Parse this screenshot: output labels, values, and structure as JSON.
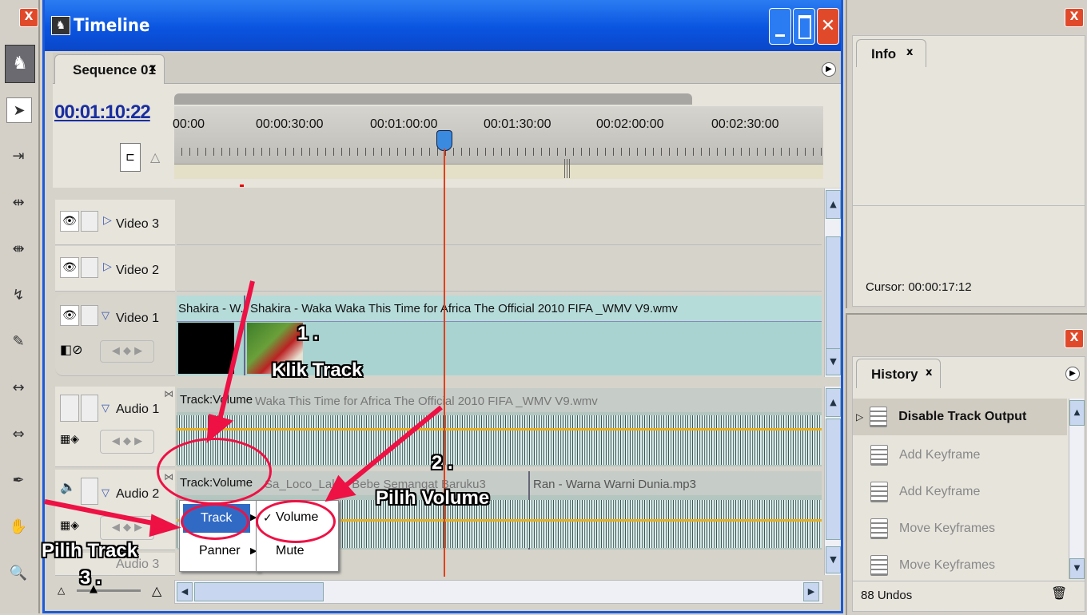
{
  "tools": {
    "close": "X"
  },
  "timeline": {
    "title": "Timeline",
    "tab": "Sequence 01",
    "tab_close": "x",
    "timecode": "00:01:10:22",
    "ruler": [
      "00:00",
      "00:00:30:00",
      "00:01:00:00",
      "00:01:30:00",
      "00:02:00:00",
      "00:02:30:00"
    ],
    "tracks": {
      "video3": "Video 3",
      "video2": "Video 2",
      "video1": "Video 1",
      "audio1": "Audio 1",
      "audio2": "Audio 2",
      "audio3": "Audio 3"
    },
    "clips": {
      "v1_a": "Shakira - W.",
      "v1_b": "Shakira - Waka Waka This Time for Africa The Official 2010 FIFA _WMV V9.wmv",
      "a1_sel": "Track:Volume",
      "a1_name": "Waka This Time for Africa The Official 2010 FIFA _WMV V9.wmv",
      "a2_sel": "Track:Volume",
      "a2_name": "Sa_Loco_Lala - Bebe Semangat Baruku3",
      "a2_name2": "Ran - Warna Warni Dunia.mp3"
    },
    "menu": {
      "track": "Track",
      "panner": "Panner",
      "volume": "Volume",
      "mute": "Mute",
      "check": "✓"
    },
    "annotations": {
      "n1": "1 .",
      "klik": "Klik Track",
      "n2": "2 .",
      "pilih_volume": "Pilih Volume",
      "pilih_track": "Pilih Track",
      "n3": "3 ."
    }
  },
  "info": {
    "tab": "Info",
    "tab_close": "x",
    "cursor": "Cursor:  00:00:17:12"
  },
  "history": {
    "tab": "History",
    "tab_close": "x",
    "items": [
      "Disable Track Output",
      "Add Keyframe",
      "Add Keyframe",
      "Move Keyframes",
      "Move Keyframes"
    ],
    "undos": "88 Undos"
  },
  "colors": {
    "titlebar": "#0a54e0",
    "accent": "#ee1144",
    "clip": "#a9d3d1",
    "playhead": "#e0401a"
  }
}
